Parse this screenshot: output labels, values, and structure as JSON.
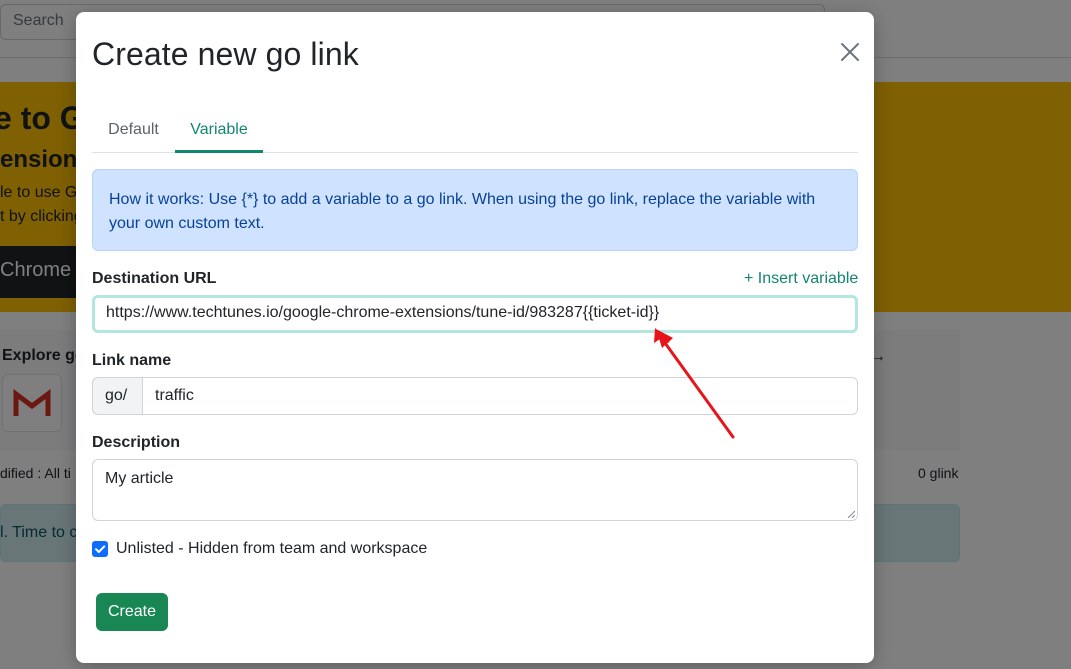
{
  "background": {
    "search_placeholder": "Search",
    "banner_title": "e to G",
    "banner_subtitle": "ension",
    "banner_line1": "le to use G",
    "banner_line2": "t by clicking",
    "chrome_button": "Chrome",
    "explore_title": "Explore go",
    "arrow_glyph": "→",
    "modified_text": "dified : All ti",
    "glink_count": "0 glink",
    "alert_text": "l. Time to c"
  },
  "modal": {
    "title": "Create new go link",
    "close_glyph": "×",
    "tabs": [
      {
        "label": "Default",
        "active": false
      },
      {
        "label": "Variable",
        "active": true
      }
    ],
    "info_text": "How it works: Use {*} to add a variable to a go link. When using the go link, replace the variable with your own custom text.",
    "destination": {
      "label": "Destination URL",
      "insert_variable": "+ Insert variable",
      "value": "https://www.techtunes.io/google-chrome-extensions/tune-id/983287{{ticket-id}}"
    },
    "link_name": {
      "label": "Link name",
      "prefix": "go/",
      "value": "traffic"
    },
    "description": {
      "label": "Description",
      "value": "My article"
    },
    "unlisted": {
      "checked": true,
      "label": "Unlisted - Hidden from team and workspace"
    },
    "create_button": "Create"
  },
  "colors": {
    "accent": "#13866f",
    "primary_button": "#198754",
    "checkbox": "#0d6efd",
    "info_bg": "#cfe2ff",
    "banner": "#ffc107",
    "annotation_arrow": "#e8141b"
  }
}
